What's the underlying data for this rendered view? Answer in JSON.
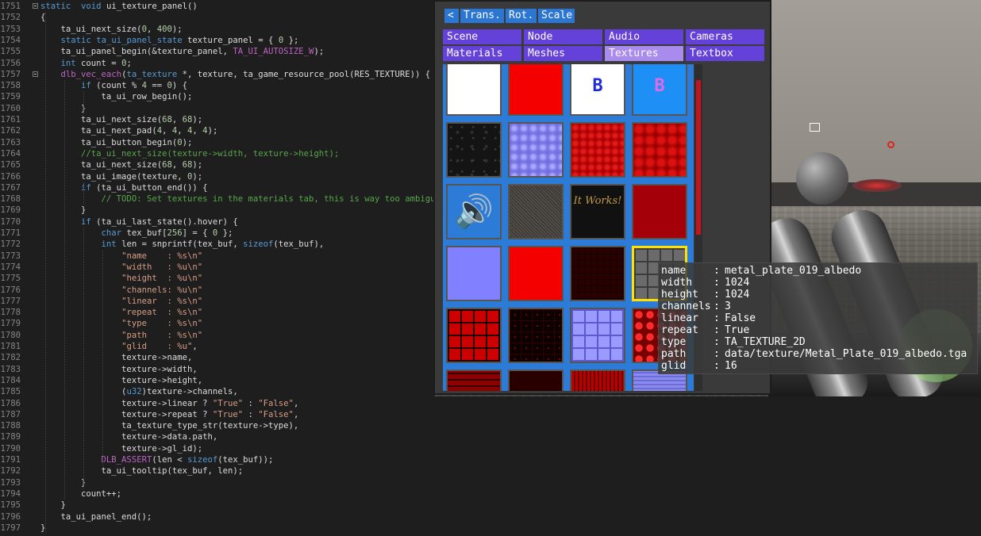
{
  "editor": {
    "lines": [
      {
        "no": "1751",
        "fold": true,
        "segs": [
          [
            "kw",
            "static"
          ],
          [
            "",
            "  "
          ],
          [
            "kw",
            "void"
          ],
          [
            "",
            " ui_texture_panel()"
          ]
        ]
      },
      {
        "no": "1752",
        "segs": [
          [
            "",
            "{"
          ]
        ]
      },
      {
        "no": "1753",
        "segs": [
          [
            "",
            "    ta_ui_next_size("
          ],
          [
            "num",
            "0"
          ],
          [
            "",
            ", "
          ],
          [
            "num",
            "400"
          ],
          [
            "",
            ");"
          ]
        ]
      },
      {
        "no": "1754",
        "segs": [
          [
            "",
            "    "
          ],
          [
            "kw",
            "static"
          ],
          [
            "",
            ""
          ],
          [
            "",
            ""
          ],
          [
            "",
            ""
          ],
          [
            "",
            " "
          ],
          [
            "kw",
            "ta_ui_panel_state"
          ],
          [
            "",
            " texture_panel = { "
          ],
          [
            "num",
            "0"
          ],
          [
            "",
            " };"
          ]
        ]
      },
      {
        "no": "1755",
        "segs": [
          [
            "",
            "    ta_ui_panel_begin(&texture_panel, "
          ],
          [
            "mac",
            "TA_UI_AUTOSIZE_W"
          ],
          [
            "",
            ");"
          ]
        ]
      },
      {
        "no": "1756",
        "segs": [
          [
            "",
            "    "
          ],
          [
            "kw",
            "int"
          ],
          [
            "",
            " count = "
          ],
          [
            "num",
            "0"
          ],
          [
            "",
            ";"
          ]
        ]
      },
      {
        "no": "1757",
        "fold": true,
        "segs": [
          [
            "",
            "    "
          ],
          [
            "mac",
            "dlb_vec_each"
          ],
          [
            "",
            "("
          ],
          [
            "kw",
            "ta_texture"
          ],
          [
            "",
            " *, texture, ta_game_resource_pool(RES_TEXTURE)) {"
          ]
        ]
      },
      {
        "no": "1758",
        "segs": [
          [
            "",
            "        "
          ],
          [
            "kw",
            "if"
          ],
          [
            "",
            " (count % "
          ],
          [
            "num",
            "4"
          ],
          [
            "",
            " == "
          ],
          [
            "num",
            "0"
          ],
          [
            "",
            ") {"
          ]
        ]
      },
      {
        "no": "1759",
        "segs": [
          [
            "",
            "            ta_ui_row_begin();"
          ]
        ]
      },
      {
        "no": "1760",
        "segs": [
          [
            "",
            "        }"
          ]
        ]
      },
      {
        "no": "1761",
        "segs": [
          [
            "",
            "        ta_ui_next_size("
          ],
          [
            "num",
            "68"
          ],
          [
            "",
            ", "
          ],
          [
            "num",
            "68"
          ],
          [
            "",
            ");"
          ]
        ]
      },
      {
        "no": "1762",
        "segs": [
          [
            "",
            "        ta_ui_next_pad("
          ],
          [
            "num",
            "4"
          ],
          [
            "",
            ", "
          ],
          [
            "num",
            "4"
          ],
          [
            "",
            ", "
          ],
          [
            "num",
            "4"
          ],
          [
            "",
            ", "
          ],
          [
            "num",
            "4"
          ],
          [
            "",
            ");"
          ]
        ]
      },
      {
        "no": "1763",
        "segs": [
          [
            "",
            "        ta_ui_button_begin("
          ],
          [
            "num",
            "0"
          ],
          [
            "",
            ");"
          ]
        ]
      },
      {
        "no": "1764",
        "segs": [
          [
            "",
            "        "
          ],
          [
            "cm",
            "//ta_ui_next_size(texture->width, texture->height);"
          ]
        ]
      },
      {
        "no": "1765",
        "segs": [
          [
            "",
            "        ta_ui_next_size("
          ],
          [
            "num",
            "68"
          ],
          [
            "",
            ", "
          ],
          [
            "num",
            "68"
          ],
          [
            "",
            ");"
          ]
        ]
      },
      {
        "no": "1766",
        "segs": [
          [
            "",
            "        ta_ui_image(texture, "
          ],
          [
            "num",
            "0"
          ],
          [
            "",
            ");"
          ]
        ]
      },
      {
        "no": "1767",
        "segs": [
          [
            "",
            "        "
          ],
          [
            "kw",
            "if"
          ],
          [
            "",
            " (ta_ui_button_end()) {"
          ]
        ]
      },
      {
        "no": "1768",
        "segs": [
          [
            "",
            "            "
          ],
          [
            "cm",
            "// TODO: Set textures in the materials tab, this is way too ambiguous"
          ]
        ]
      },
      {
        "no": "1769",
        "segs": [
          [
            "",
            "        }"
          ]
        ]
      },
      {
        "no": "1770",
        "segs": [
          [
            "",
            "        "
          ],
          [
            "kw",
            "if"
          ],
          [
            "",
            " (ta_ui_last_state().hover) {"
          ]
        ]
      },
      {
        "no": "1771",
        "segs": [
          [
            "",
            "            "
          ],
          [
            "kw",
            "char"
          ],
          [
            "",
            " tex_buf["
          ],
          [
            "num",
            "256"
          ],
          [
            "",
            "] = { "
          ],
          [
            "num",
            "0"
          ],
          [
            "",
            " };"
          ]
        ]
      },
      {
        "no": "1772",
        "segs": [
          [
            "",
            "            "
          ],
          [
            "kw",
            "int"
          ],
          [
            "",
            " len = snprintf(tex_buf, "
          ],
          [
            "kw",
            "sizeof"
          ],
          [
            "",
            "(tex_buf),"
          ]
        ]
      },
      {
        "no": "1773",
        "segs": [
          [
            "",
            "                "
          ],
          [
            "str",
            "\"name    : %s\\n\""
          ]
        ]
      },
      {
        "no": "1774",
        "segs": [
          [
            "",
            "                "
          ],
          [
            "str",
            "\"width   : %u\\n\""
          ]
        ]
      },
      {
        "no": "1775",
        "segs": [
          [
            "",
            "                "
          ],
          [
            "str",
            "\"height  : %u\\n\""
          ]
        ]
      },
      {
        "no": "1776",
        "segs": [
          [
            "",
            "                "
          ],
          [
            "str",
            "\"channels: %u\\n\""
          ]
        ]
      },
      {
        "no": "1777",
        "segs": [
          [
            "",
            "                "
          ],
          [
            "str",
            "\"linear  : %s\\n\""
          ]
        ]
      },
      {
        "no": "1778",
        "segs": [
          [
            "",
            "                "
          ],
          [
            "str",
            "\"repeat  : %s\\n\""
          ]
        ]
      },
      {
        "no": "1779",
        "segs": [
          [
            "",
            "                "
          ],
          [
            "str",
            "\"type    : %s\\n\""
          ]
        ]
      },
      {
        "no": "1780",
        "segs": [
          [
            "",
            "                "
          ],
          [
            "str",
            "\"path    : %s\\n\""
          ]
        ]
      },
      {
        "no": "1781",
        "segs": [
          [
            "",
            "                "
          ],
          [
            "str",
            "\"glid    : %u\""
          ],
          [
            "",
            ","
          ]
        ]
      },
      {
        "no": "1782",
        "segs": [
          [
            "",
            "                texture->name,"
          ]
        ]
      },
      {
        "no": "1783",
        "segs": [
          [
            "",
            "                texture->width,"
          ]
        ]
      },
      {
        "no": "1784",
        "segs": [
          [
            "",
            "                texture->height,"
          ]
        ]
      },
      {
        "no": "1785",
        "segs": [
          [
            "",
            "                ("
          ],
          [
            "kw",
            "u32"
          ],
          [
            "",
            ")texture->channels,"
          ]
        ]
      },
      {
        "no": "1786",
        "segs": [
          [
            "",
            "                texture->linear ? "
          ],
          [
            "str",
            "\"True\""
          ],
          [
            "",
            " : "
          ],
          [
            "str",
            "\"False\""
          ],
          [
            "",
            ","
          ]
        ]
      },
      {
        "no": "1787",
        "segs": [
          [
            "",
            "                texture->repeat ? "
          ],
          [
            "str",
            "\"True\""
          ],
          [
            "",
            " : "
          ],
          [
            "str",
            "\"False\""
          ],
          [
            "",
            ","
          ]
        ]
      },
      {
        "no": "1788",
        "segs": [
          [
            "",
            "                ta_texture_type_str(texture->type),"
          ]
        ]
      },
      {
        "no": "1789",
        "segs": [
          [
            "",
            "                texture->data.path,"
          ]
        ]
      },
      {
        "no": "1790",
        "segs": [
          [
            "",
            "                texture->gl_id);"
          ]
        ]
      },
      {
        "no": "1791",
        "segs": [
          [
            "",
            "            "
          ],
          [
            "mac",
            "DLB_ASSERT"
          ],
          [
            "",
            "(len < "
          ],
          [
            "kw",
            "sizeof"
          ],
          [
            "",
            "(tex_buf));"
          ]
        ]
      },
      {
        "no": "1792",
        "segs": [
          [
            "",
            "            ta_ui_tooltip(tex_buf, len);"
          ]
        ]
      },
      {
        "no": "1793",
        "segs": [
          [
            "",
            "        }"
          ]
        ]
      },
      {
        "no": "1794",
        "segs": [
          [
            "",
            "        count++;"
          ]
        ]
      },
      {
        "no": "1795",
        "segs": [
          [
            "",
            "    }"
          ]
        ]
      },
      {
        "no": "1796",
        "segs": [
          [
            "",
            "    ta_ui_panel_end();"
          ]
        ]
      },
      {
        "no": "1797",
        "segs": [
          [
            "",
            "}"
          ]
        ]
      }
    ]
  },
  "toolbar": {
    "back": "<",
    "trans": "Trans.",
    "rot": "Rot.",
    "scale": "Scale"
  },
  "tabs": [
    {
      "label": "Scene",
      "active": false
    },
    {
      "label": "Node",
      "active": false
    },
    {
      "label": "Audio",
      "active": false
    },
    {
      "label": "Cameras",
      "active": false
    },
    {
      "label": "Materials",
      "active": false
    },
    {
      "label": "Meshes",
      "active": false
    },
    {
      "label": "Textures",
      "active": true
    },
    {
      "label": "Textbox",
      "active": false
    }
  ],
  "textures": [
    {
      "style": "t-white",
      "label": ""
    },
    {
      "style": "t-red",
      "label": ""
    },
    {
      "style": "t-b",
      "label": "B"
    },
    {
      "style": "t-b2",
      "label": "B"
    },
    {
      "style": "t-dark",
      "label": ""
    },
    {
      "style": "t-normal",
      "label": ""
    },
    {
      "style": "t-redtex",
      "label": ""
    },
    {
      "style": "t-redtex2",
      "label": ""
    },
    {
      "style": "t-speaker",
      "label": "🔊"
    },
    {
      "style": "t-noise",
      "label": ""
    },
    {
      "style": "t-itworks",
      "label": "It Works!"
    },
    {
      "style": "t-maroon",
      "label": ""
    },
    {
      "style": "t-periwinkle",
      "label": ""
    },
    {
      "style": "t-red",
      "label": ""
    },
    {
      "style": "t-redgrid",
      "label": ""
    },
    {
      "style": "t-metal",
      "label": "",
      "selected": true
    },
    {
      "style": "t-redtiles",
      "label": ""
    },
    {
      "style": "t-darkred",
      "label": ""
    },
    {
      "style": "t-bluetiles",
      "label": ""
    },
    {
      "style": "t-redcircles",
      "label": ""
    },
    {
      "style": "t-redbrick",
      "label": ""
    },
    {
      "style": "t-darkmaroon",
      "label": ""
    },
    {
      "style": "t-redstripes",
      "label": ""
    },
    {
      "style": "t-bluestripes",
      "label": ""
    }
  ],
  "tooltip": {
    "rows": [
      {
        "key": "name",
        "value": "metal_plate_019_albedo"
      },
      {
        "key": "width",
        "value": "1024"
      },
      {
        "key": "height",
        "value": "1024"
      },
      {
        "key": "channels",
        "value": "3"
      },
      {
        "key": "linear",
        "value": "False"
      },
      {
        "key": "repeat",
        "value": "True"
      },
      {
        "key": "type",
        "value": "TA_TEXTURE_2D"
      },
      {
        "key": "path",
        "value": "data/texture/Metal_Plate_019_albedo.tga"
      },
      {
        "key": "glid",
        "value": "16"
      }
    ],
    "separator": ":"
  },
  "colors": {
    "tab": "#6441d9",
    "tab_active": "#a98bee",
    "toolbar": "#2a76d2",
    "grid": "#2c7bd6",
    "selection": "#ffe000",
    "scrollbar": "#c4141d"
  }
}
